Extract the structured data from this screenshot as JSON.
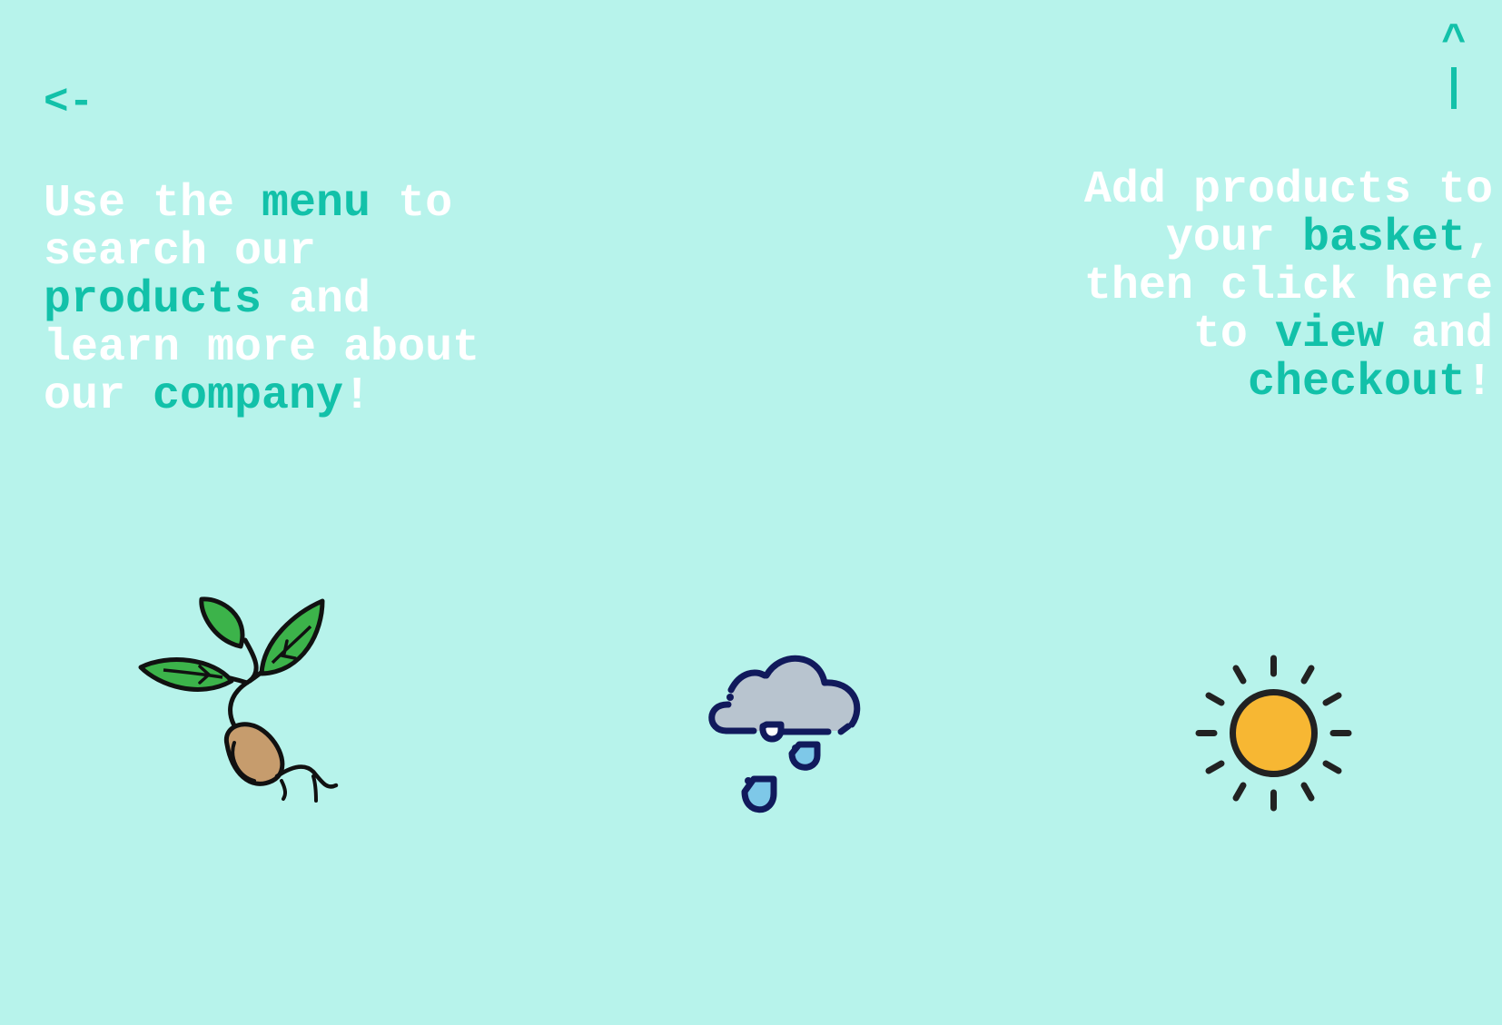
{
  "nav_hints": {
    "menu_arrow": "<-",
    "basket_arrow_caret": "^"
  },
  "hint_left": {
    "l1a": "Use the ",
    "l1b": "menu",
    "l1c": " to",
    "l2": "search our",
    "l3a": "products",
    "l3b": " and",
    "l4": "learn more about",
    "l5a": "our ",
    "l5b": "company",
    "l5c": "!"
  },
  "hint_right": {
    "l1": "Add products to",
    "l2a": "your ",
    "l2b": "basket",
    "l2c": ",",
    "l3": "then click here",
    "l4a": "to ",
    "l4b": "view",
    "l4c": " and",
    "l5a": "checkout",
    "l5b": "!"
  },
  "colors": {
    "background": "#b7f3eb",
    "accent": "#12c1a9",
    "text": "#ffffff"
  },
  "icons": [
    "sprout-icon",
    "rain-cloud-icon",
    "sun-icon"
  ]
}
